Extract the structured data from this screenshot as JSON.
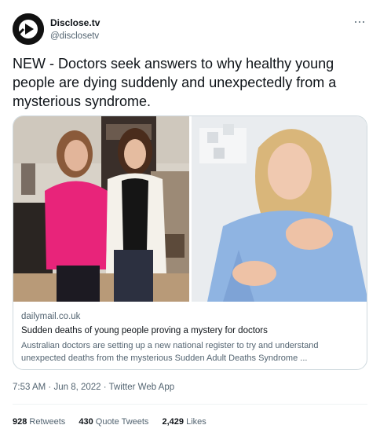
{
  "author": {
    "display_name": "Disclose.tv",
    "handle": "@disclosetv",
    "avatar_icon": "disclose-tv-play-logo-icon"
  },
  "tweet": {
    "text": "NEW - Doctors seek answers to why healthy young people are dying suddenly and unexpectedly from a mysterious syndrome."
  },
  "link_card": {
    "domain": "dailymail.co.uk",
    "title": "Sudden deaths of young people proving a mystery for doctors",
    "description": "Australian doctors are setting up a new national register to try and understand unexpected deaths from the mysterious Sudden Adult Deaths Syndrome ..."
  },
  "meta": {
    "time": "7:53 AM",
    "separator": "·",
    "date": "Jun 8, 2022",
    "source": "Twitter Web App"
  },
  "stats": {
    "retweets_count": "928",
    "retweets_label": "Retweets",
    "quotes_count": "430",
    "quotes_label": "Quote Tweets",
    "likes_count": "2,429",
    "likes_label": "Likes"
  },
  "colors": {
    "text_primary": "#0f1419",
    "text_secondary": "#536471",
    "border": "#cfd9de",
    "divider": "#eff3f4"
  }
}
